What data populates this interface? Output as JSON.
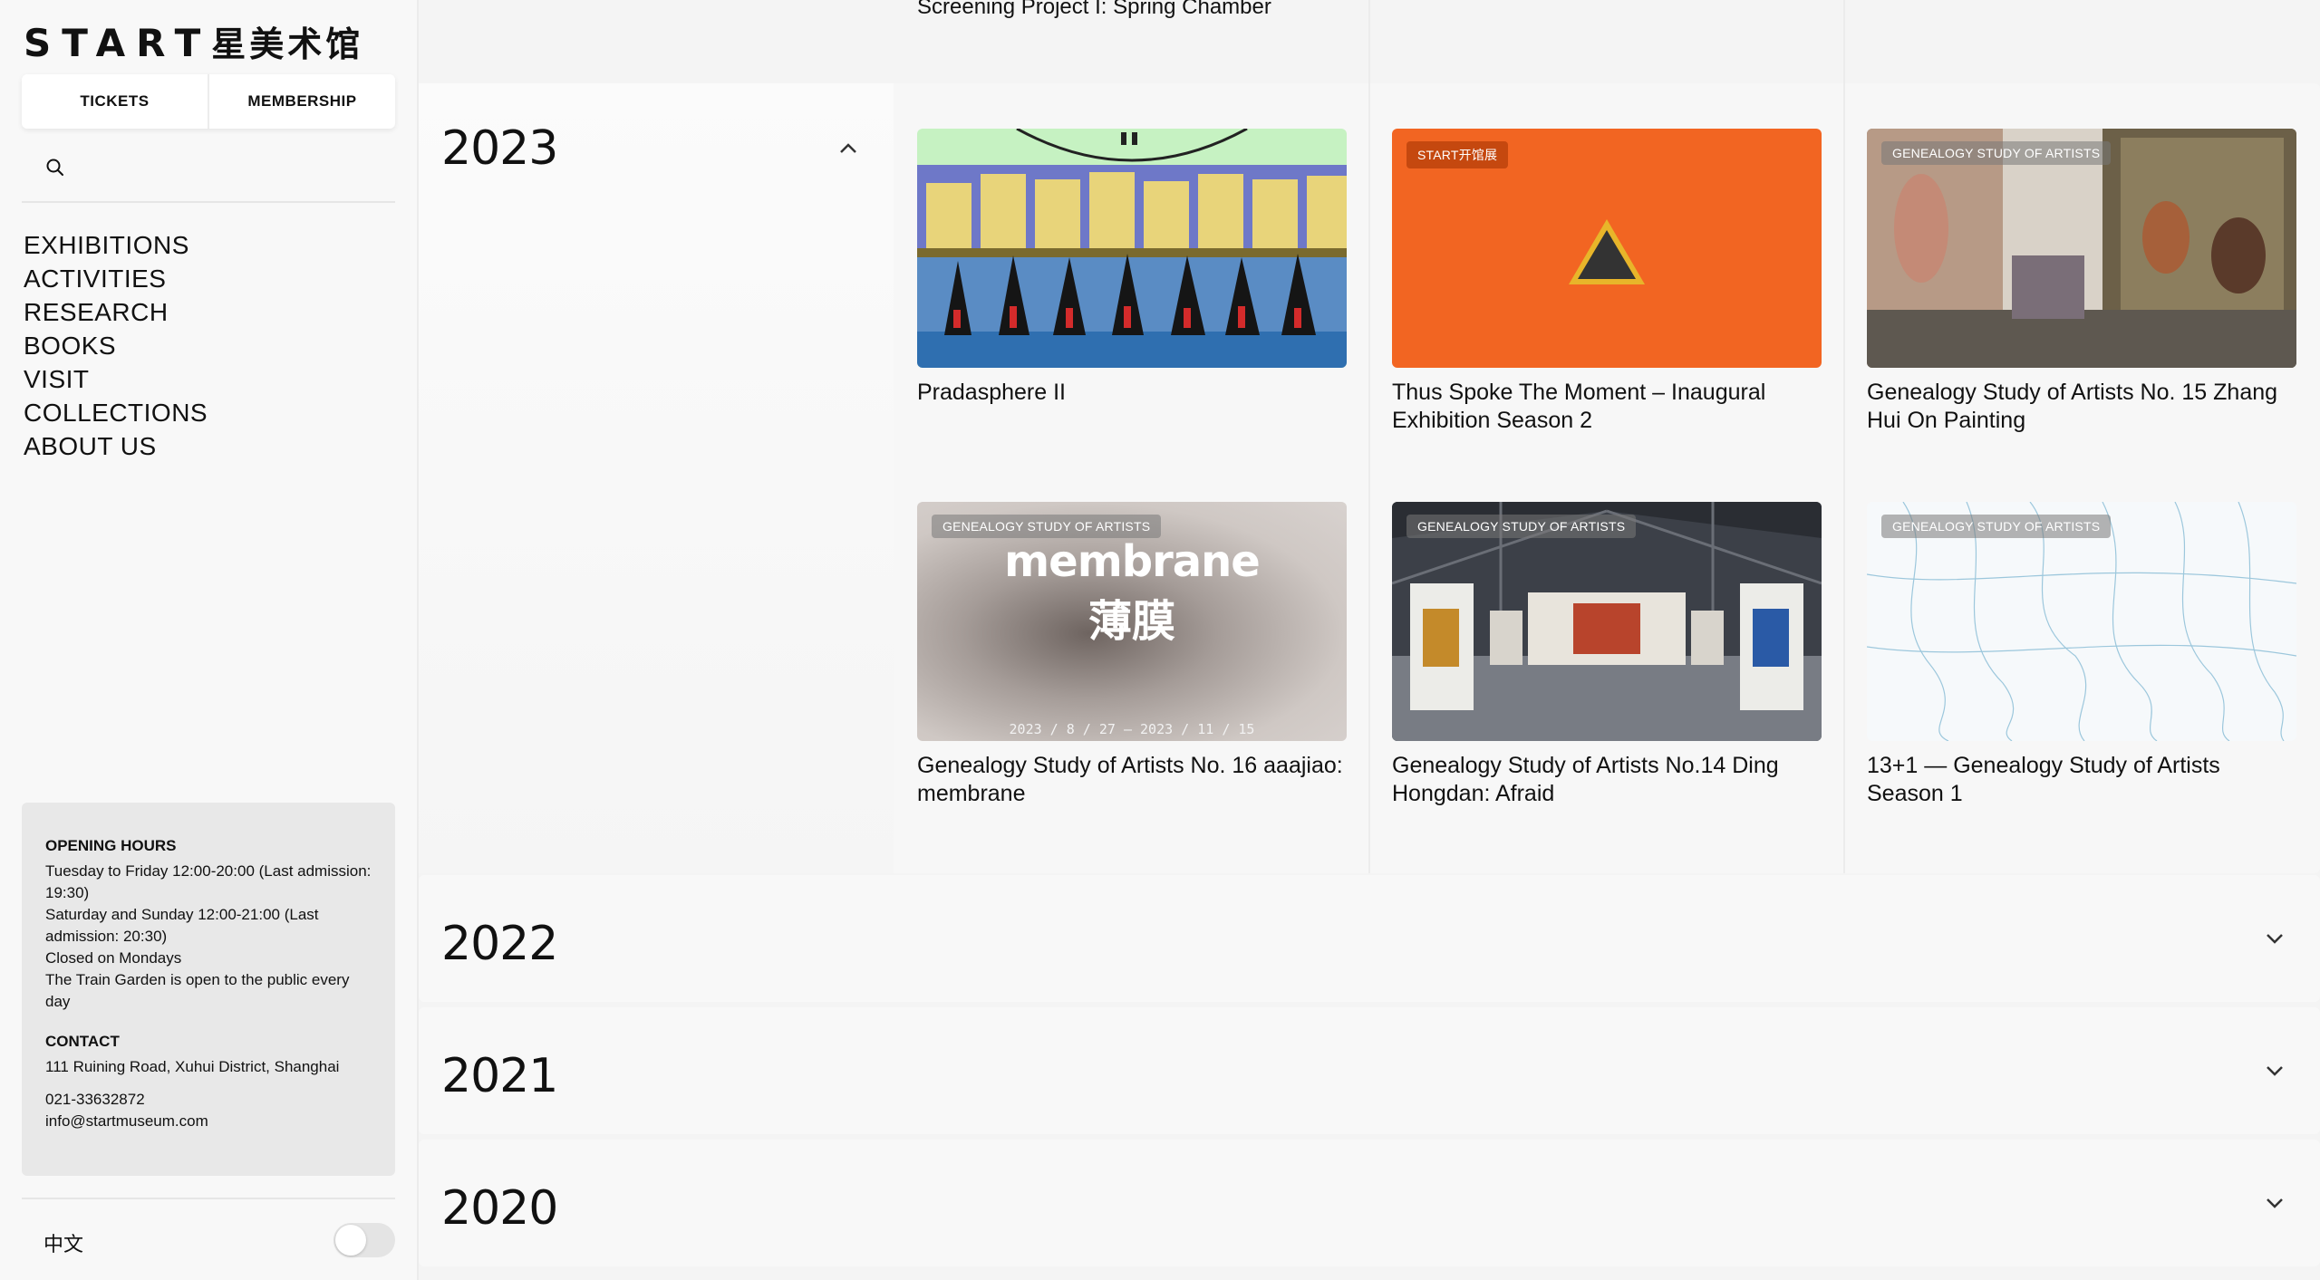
{
  "brand": {
    "name": "START",
    "name_cn": "星美术馆"
  },
  "sidebar": {
    "tickets_label": "TICKETS",
    "membership_label": "MEMBERSHIP",
    "nav": [
      "EXHIBITIONS",
      "ACTIVITIES",
      "RESEARCH",
      "BOOKS",
      "VISIT",
      "COLLECTIONS",
      "ABOUT US"
    ],
    "opening": {
      "heading": "OPENING HOURS",
      "lines": [
        "Tuesday to Friday 12:00-20:00 (Last admission: 19:30)",
        "Saturday and Sunday 12:00-21:00 (Last admission: 20:30)",
        "Closed on Mondays",
        "The Train Garden is open to the public every day"
      ]
    },
    "contact": {
      "heading": "CONTACT",
      "address": "111 Ruining Road, Xuhui District, Shanghai",
      "phone": "021-33632872",
      "email": "info@startmuseum.com"
    },
    "language_label": "中文"
  },
  "main": {
    "previous_title": "Screening Project I: Spring Chamber",
    "expanded_year": "2023",
    "cards": [
      {
        "title": "Pradasphere II",
        "tag": ""
      },
      {
        "title": "Thus Spoke The Moment – Inaugural Exhibition Season 2",
        "tag": "START开馆展"
      },
      {
        "title": "Genealogy Study of Artists No. 15 Zhang Hui On Painting",
        "tag": "GENEALOGY STUDY OF ARTISTS"
      },
      {
        "title": "Genealogy Study of Artists No. 16 aaajiao: membrane",
        "tag": "GENEALOGY STUDY OF ARTISTS",
        "art_text": "membrane",
        "art_cn": "薄膜",
        "art_dates": "2023 / 8 / 27 — 2023 / 11 / 15"
      },
      {
        "title": "Genealogy Study of Artists No.14 Ding Hongdan: Afraid",
        "tag": "GENEALOGY STUDY OF ARTISTS"
      },
      {
        "title": "13+1 — Genealogy Study of Artists Season 1",
        "tag": "GENEALOGY STUDY OF ARTISTS"
      }
    ],
    "collapsed_years": [
      "2022",
      "2021",
      "2020"
    ]
  },
  "colors": {
    "accent_orange": "#f26522",
    "pale_green": "#c6f2c2"
  }
}
